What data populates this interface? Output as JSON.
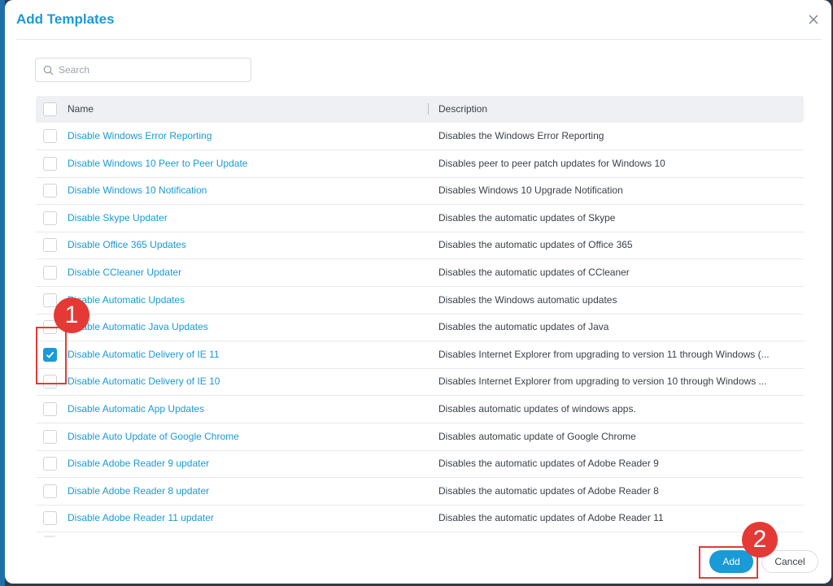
{
  "dialog": {
    "title": "Add Templates",
    "close_icon": "close-icon"
  },
  "search": {
    "placeholder": "Search",
    "value": "",
    "icon": "search-icon"
  },
  "table": {
    "headers": {
      "name": "Name",
      "description": "Description"
    },
    "rows": [
      {
        "name": "Disable Windows Error Reporting",
        "description": "Disables the Windows Error Reporting",
        "checked": false
      },
      {
        "name": "Disable Windows 10 Peer to Peer Update",
        "description": "Disables peer to peer patch updates for Windows 10",
        "checked": false
      },
      {
        "name": "Disable Windows 10 Notification",
        "description": "Disables Windows 10 Upgrade Notification",
        "checked": false
      },
      {
        "name": "Disable Skype Updater",
        "description": "Disables the automatic updates of Skype",
        "checked": false
      },
      {
        "name": "Disable Office 365 Updates",
        "description": "Disables the automatic updates of Office 365",
        "checked": false
      },
      {
        "name": "Disable CCleaner Updater",
        "description": "Disables the automatic updates of CCleaner",
        "checked": false
      },
      {
        "name": "Disable Automatic Updates",
        "description": "Disables the Windows automatic updates",
        "checked": false
      },
      {
        "name": "Disable Automatic Java Updates",
        "description": "Disables the automatic updates of Java",
        "checked": false
      },
      {
        "name": "Disable Automatic Delivery of IE 11",
        "description": "Disables Internet Explorer from upgrading to version 11 through Windows (...",
        "checked": true
      },
      {
        "name": "Disable Automatic Delivery of IE 10",
        "description": "Disables Internet Explorer from upgrading to version 10 through Windows ...",
        "checked": false
      },
      {
        "name": "Disable Automatic App Updates",
        "description": "Disables automatic updates of windows apps.",
        "checked": false
      },
      {
        "name": "Disable Auto Update of Google Chrome",
        "description": "Disables automatic update of Google Chrome",
        "checked": false
      },
      {
        "name": "Disable Adobe Reader 9 updater",
        "description": "Disables the automatic updates of Adobe Reader 9",
        "checked": false
      },
      {
        "name": "Disable Adobe Reader 8 updater",
        "description": "Disables the automatic updates of Adobe Reader 8",
        "checked": false
      },
      {
        "name": "Disable Adobe Reader 11 updater",
        "description": "Disables the automatic updates of Adobe Reader 11",
        "checked": false
      }
    ]
  },
  "annotations": {
    "step1": "1",
    "step2": "2",
    "color": "#e53935"
  },
  "footer": {
    "add_label": "Add",
    "cancel_label": "Cancel"
  },
  "colors": {
    "accent": "#1a9ad6",
    "header_bg": "#eef0f3",
    "text": "#3b4148"
  }
}
